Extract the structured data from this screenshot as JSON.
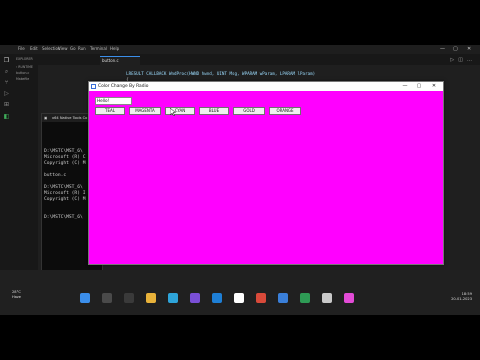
{
  "vscode": {
    "menu": [
      "File",
      "Edit",
      "Selection",
      "View",
      "Go",
      "Run",
      "Terminal",
      "Help"
    ],
    "window_controls": [
      "—",
      "▢",
      "✕"
    ],
    "explorer_title": "EXPLORER",
    "explorer_items": [
      "› RUNTIME",
      "button.c",
      "Makefile"
    ],
    "outline_items": [
      "› OUTLINE",
      "› TIMELINE"
    ],
    "tab_label": "button.c",
    "code_lines": [
      {
        "text": "    LRESULT CALLBACK WndProc(HWND hwnd, UINT Msg, WPARAM wParam, LPARAM lParam)",
        "color": "#9cdcfe"
      },
      {
        "text": "    {",
        "color": "#d4d4d4"
      }
    ],
    "activity_icons": [
      "files-icon",
      "search-icon",
      "source-control-icon",
      "run-debug-icon",
      "extensions-icon",
      "account-icon",
      "settings-icon"
    ]
  },
  "cmd": {
    "title": "x64 Native Tools Co",
    "lines": [
      "D:\\MSTC\\MST_6\\",
      "Microsoft (R) C",
      "Copyright (C) M",
      "",
      "button.c",
      "",
      "D:\\MSTC\\MST_6\\",
      "Microsoft (R) I",
      "Copyright (C) M",
      "",
      "D:\\MSTC\\MST_6\\"
    ]
  },
  "app": {
    "title": "Color Change By Radio",
    "hello_text": "Hello!",
    "client_color": "#ff00ff",
    "buttons": [
      {
        "label": "TEAL"
      },
      {
        "label": "MAGENTA"
      },
      {
        "label": "CYAN"
      },
      {
        "label": "BLUE"
      },
      {
        "label": "GOLD"
      },
      {
        "label": "ORANGE"
      }
    ],
    "window_controls": [
      "—",
      "▢",
      "✕"
    ]
  },
  "taskbar": {
    "weather_temp": "28°C",
    "weather_desc": "Haze",
    "time": "18:59",
    "date": "20-01-2023",
    "lang": "ENG\nIN"
  }
}
